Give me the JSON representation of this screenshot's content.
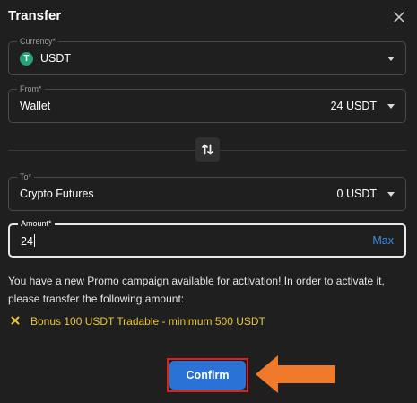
{
  "modal": {
    "title": "Transfer",
    "close_icon": "close-icon"
  },
  "currency": {
    "label": "Currency*",
    "token_icon": "tether-icon",
    "token_glyph": "T",
    "value": "USDT"
  },
  "from": {
    "label": "From*",
    "value": "Wallet",
    "balance": "24 USDT"
  },
  "swap_icon": "swap-vertical-icon",
  "to": {
    "label": "To*",
    "value": "Crypto Futures",
    "balance": "0 USDT"
  },
  "amount": {
    "label": "Amount*",
    "value": "24",
    "max_label": "Max"
  },
  "promo": {
    "message": "You have a new Promo campaign available for activation! In order to activate it, please transfer the following amount:",
    "bonus_icon": "x-icon",
    "bonus_text": "Bonus 100 USDT Tradable - minimum 500 USDT"
  },
  "confirm_label": "Confirm",
  "colors": {
    "background": "#1f1f1f",
    "accent": "#2a72d6",
    "bonus": "#e8c53a",
    "max_link": "#3b8fe3",
    "highlight": "#e11d1d",
    "arrow": "#f07a2a",
    "token": "#26a17b"
  }
}
